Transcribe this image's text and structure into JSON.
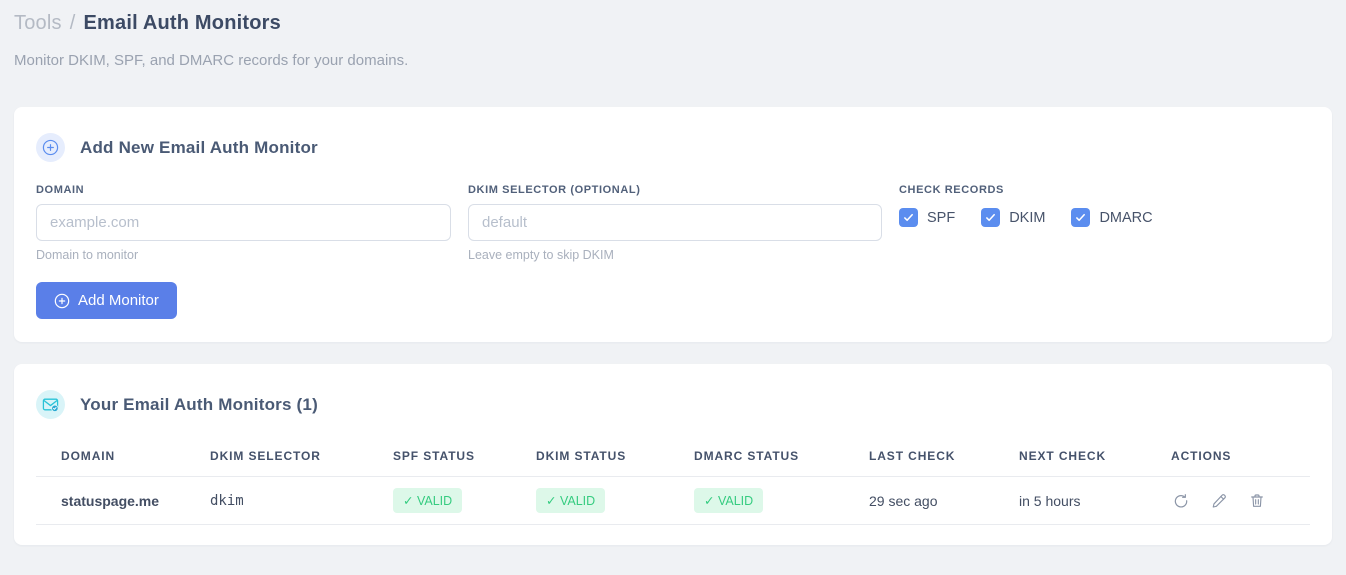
{
  "page": {
    "breadcrumb_root": "Tools",
    "breadcrumb_separator": "/",
    "title": "Email Auth Monitors",
    "subtitle": "Monitor DKIM, SPF, and DMARC records for your domains."
  },
  "add_form": {
    "title": "Add New Email Auth Monitor",
    "fields": {
      "domain": {
        "label": "DOMAIN",
        "value": "",
        "placeholder": "example.com",
        "helper": "Domain to monitor"
      },
      "dkim_selector": {
        "label": "DKIM SELECTOR (OPTIONAL)",
        "value": "",
        "placeholder": "default",
        "helper": "Leave empty to skip DKIM"
      }
    },
    "check_records": {
      "label": "CHECK RECORDS",
      "options": [
        {
          "label": "SPF",
          "checked": true
        },
        {
          "label": "DKIM",
          "checked": true
        },
        {
          "label": "DMARC",
          "checked": true
        }
      ]
    },
    "submit_label": "Add Monitor"
  },
  "monitors": {
    "title": "Your Email Auth Monitors (1)",
    "count": 1,
    "table": {
      "columns": [
        "DOMAIN",
        "DKIM SELECTOR",
        "SPF STATUS",
        "DKIM STATUS",
        "DMARC STATUS",
        "LAST CHECK",
        "NEXT CHECK",
        "ACTIONS"
      ],
      "rows": [
        {
          "domain": "statuspage.me",
          "dkim_selector": "dkim",
          "spf_status": "✓ VALID",
          "dkim_status": "✓ VALID",
          "dmarc_status": "✓ VALID",
          "last_check": "29 sec ago",
          "next_check": "in 5 hours",
          "actions": [
            "refresh",
            "edit",
            "delete"
          ]
        }
      ]
    }
  },
  "icons": {
    "add_circle": "plus-circle-icon",
    "mail_check": "envelope-check-icon",
    "refresh": "refresh-icon",
    "edit": "pencil-icon",
    "delete": "trash-icon"
  },
  "colors": {
    "accent_blue": "#5a7fe8",
    "checkbox_blue": "#5b8def",
    "badge_green_bg": "#ddf8e9",
    "badge_green_text": "#35cc80",
    "selector_pink": "#ec5f8d",
    "page_bg": "#f0f2f5",
    "title_navy": "#3c4a64",
    "muted_gray": "#b9c0cb"
  }
}
